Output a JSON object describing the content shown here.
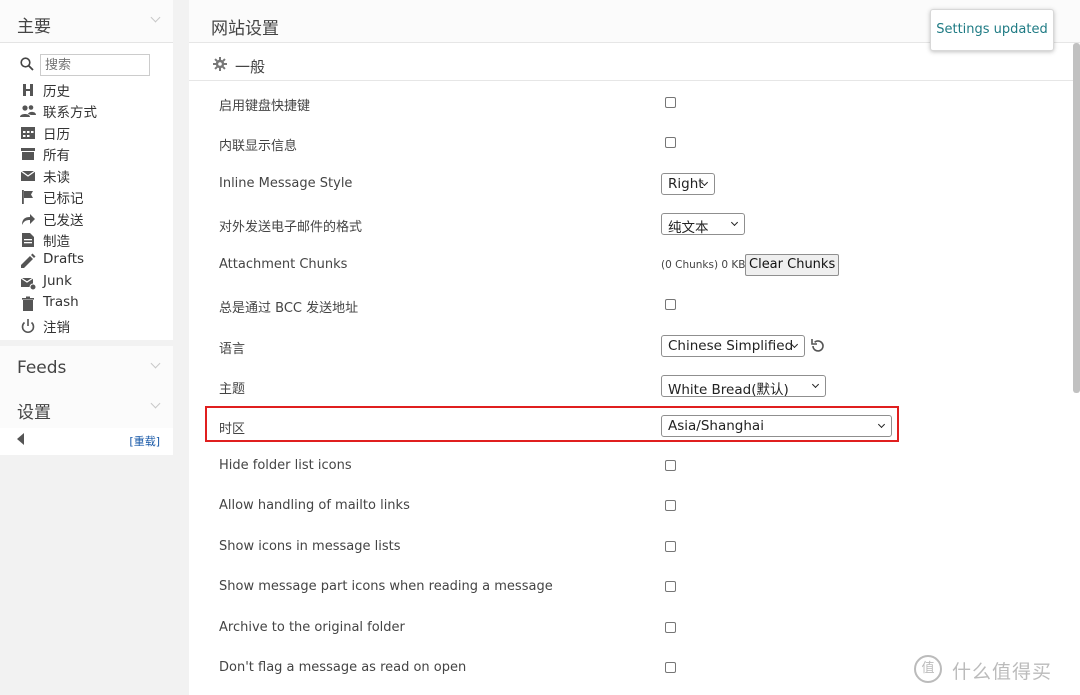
{
  "sidebar": {
    "main_title": "主要",
    "search_placeholder": "搜索",
    "items": [
      {
        "label": "历史",
        "icon": "history-icon"
      },
      {
        "label": "联系方式",
        "icon": "contacts-icon"
      },
      {
        "label": "日历",
        "icon": "calendar-icon"
      },
      {
        "label": "所有",
        "icon": "folder-icon"
      },
      {
        "label": "未读",
        "icon": "envelope-icon"
      },
      {
        "label": "已标记",
        "icon": "flag-icon"
      },
      {
        "label": "已发送",
        "icon": "send-arrow-icon"
      },
      {
        "label": "制造",
        "icon": "compose-icon"
      },
      {
        "label": "Drafts",
        "icon": "pencil-icon"
      },
      {
        "label": "Junk",
        "icon": "junk-icon"
      },
      {
        "label": "Trash",
        "icon": "trash-icon"
      },
      {
        "label": "注销",
        "icon": "power-icon"
      }
    ],
    "feeds_title": "Feeds",
    "settings_title": "设置",
    "reload_label": "[重载]"
  },
  "main": {
    "page_title": "网站设置",
    "group_title": "一般",
    "rows": [
      {
        "label": "启用键盘快捷键",
        "type": "checkbox"
      },
      {
        "label": "内联显示信息",
        "type": "checkbox"
      },
      {
        "label": "Inline Message Style",
        "type": "select",
        "value": "Right"
      },
      {
        "label": "对外发送电子邮件的格式",
        "type": "select",
        "value": "纯文本"
      },
      {
        "label": "Attachment Chunks",
        "type": "chunks",
        "info": "(0 Chunks) 0 KB",
        "button": "Clear Chunks"
      },
      {
        "label": "总是通过 BCC 发送地址",
        "type": "checkbox"
      },
      {
        "label": "语言",
        "type": "select",
        "value": "Chinese Simplified"
      },
      {
        "label": "主题",
        "type": "select",
        "value": "White Bread(默认)"
      },
      {
        "label": "时区",
        "type": "select",
        "value": "Asia/Shanghai"
      },
      {
        "label": "Hide folder list icons",
        "type": "checkbox"
      },
      {
        "label": "Allow handling of mailto links",
        "type": "checkbox"
      },
      {
        "label": "Show icons in message lists",
        "type": "checkbox"
      },
      {
        "label": "Show message part icons when reading a message",
        "type": "checkbox"
      },
      {
        "label": "Archive to the original folder",
        "type": "checkbox"
      },
      {
        "label": "Don't flag a message as read on open",
        "type": "checkbox"
      }
    ]
  },
  "toast": {
    "text": "Settings updated"
  },
  "watermark": {
    "logo": "值",
    "text": "什么值得买"
  },
  "colors": {
    "highlight": "#e01f1f",
    "toast_text": "#1f7b84",
    "link": "#1a5aa8"
  }
}
